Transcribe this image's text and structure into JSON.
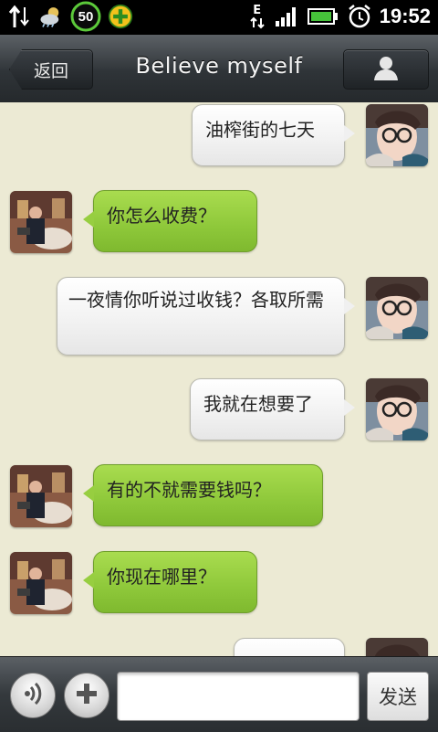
{
  "status_bar": {
    "time": "19:52",
    "battery_level_badge": "50",
    "network_type": "E",
    "icons": [
      "data-transfer-icon",
      "weather-icon",
      "battery-saver-icon",
      "security-plus-icon",
      "network-e-icon",
      "signal-strength-icon",
      "battery-icon",
      "alarm-clock-icon"
    ]
  },
  "header": {
    "back_label": "返回",
    "title": "Believe myself",
    "profile_icon": "person-icon"
  },
  "messages": [
    {
      "sender": "me",
      "text": "油榨街的七天"
    },
    {
      "sender": "other",
      "text": "你怎么收费？"
    },
    {
      "sender": "me",
      "text": "一夜情你听说过收钱？各取所需"
    },
    {
      "sender": "me",
      "text": "我就在想要了"
    },
    {
      "sender": "other",
      "text": "有的不就需要钱吗？"
    },
    {
      "sender": "other",
      "text": "你现在哪里？"
    },
    {
      "sender": "me",
      "text": ""
    }
  ],
  "input_bar": {
    "voice_icon": "voice-icon",
    "plus_icon": "plus-icon",
    "input_value": "",
    "send_label": "发送"
  }
}
